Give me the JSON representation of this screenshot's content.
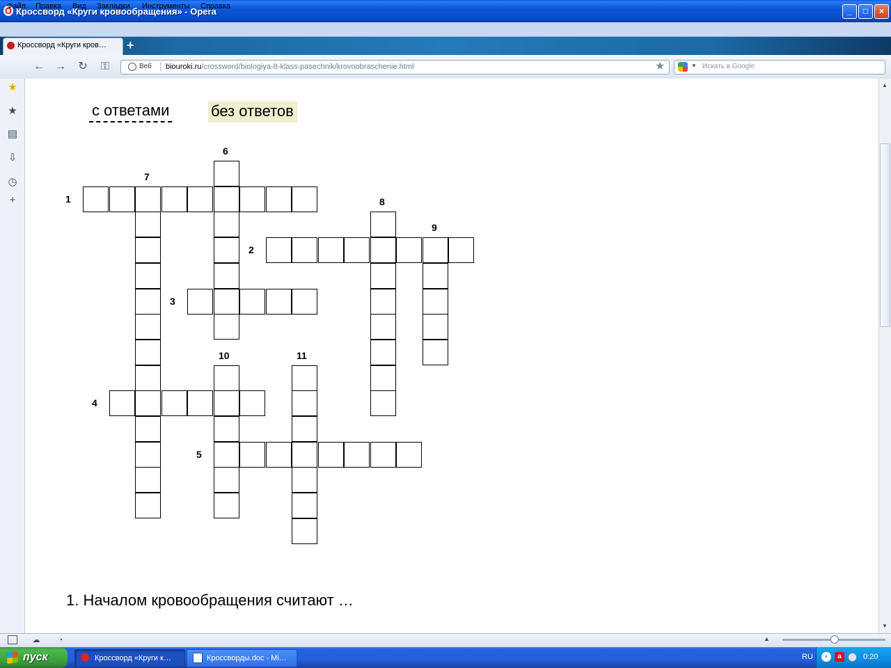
{
  "window": {
    "title": "Кроссворд «Круги кровообращения» - Opera",
    "logo_glyph": "O",
    "controls": {
      "minimize": "_",
      "maximize": "□",
      "close": "×"
    }
  },
  "menu": [
    "Файл",
    "Правка",
    "Вид",
    "Закладки",
    "Инструменты",
    "Справка"
  ],
  "tabs": {
    "active_label": "Кроссворд «Круги кров…",
    "new_tab": "+"
  },
  "nav_icons": {
    "back": "←",
    "forward": "→",
    "reload": "↻",
    "key": "⚿"
  },
  "address": {
    "badge": "Веб",
    "host": "biouroki.ru",
    "path": "/crossword/biologiya-8-klass-pasechnik/krovoobraschenie.html",
    "star": "★"
  },
  "search": {
    "placeholder": "Искать в Google"
  },
  "sidebar_icons": [
    "★",
    "★",
    "▤",
    "⇩",
    "◷",
    "+"
  ],
  "toggles": {
    "with_answers": "с ответами",
    "without_answers": "без ответов"
  },
  "crossword": {
    "numbers": [
      "1",
      "2",
      "3",
      "4",
      "5",
      "6",
      "7",
      "8",
      "9",
      "10",
      "11"
    ],
    "words": [
      {
        "num": "1",
        "dir": "across",
        "row": 1,
        "col": 0,
        "len": 9
      },
      {
        "num": "2",
        "dir": "across",
        "row": 3,
        "col": 7,
        "len": 8
      },
      {
        "num": "3",
        "dir": "across",
        "row": 5,
        "col": 4,
        "len": 5
      },
      {
        "num": "4",
        "dir": "across",
        "row": 9,
        "col": 1,
        "len": 6
      },
      {
        "num": "5",
        "dir": "across",
        "row": 11,
        "col": 5,
        "len": 8
      },
      {
        "num": "6",
        "dir": "down",
        "row": 0,
        "col": 5,
        "len": 7
      },
      {
        "num": "7",
        "dir": "down",
        "row": 1,
        "col": 2,
        "len": 13
      },
      {
        "num": "8",
        "dir": "down",
        "row": 2,
        "col": 11,
        "len": 8
      },
      {
        "num": "9",
        "dir": "down",
        "row": 3,
        "col": 13,
        "len": 5
      },
      {
        "num": "10",
        "dir": "down",
        "row": 8,
        "col": 5,
        "len": 6
      },
      {
        "num": "11",
        "dir": "down",
        "row": 8,
        "col": 8,
        "len": 7
      }
    ]
  },
  "clues": {
    "first": "1. Началом кровообращения считают …"
  },
  "statusbar": {
    "zoom_up": "▲"
  },
  "taskbar": {
    "start": "пуск",
    "items": [
      "Кроссворд «Круги к…",
      "Кроссворды.doc - Mi…"
    ],
    "lang": "RU",
    "clock": "0:20"
  }
}
